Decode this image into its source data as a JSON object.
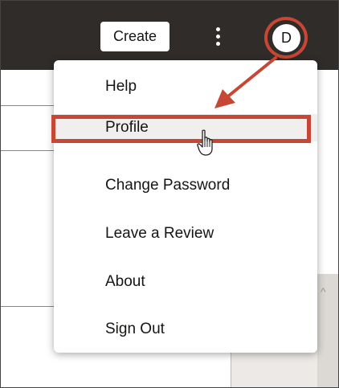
{
  "header": {
    "create_label": "Create",
    "avatar_initial": "D"
  },
  "menu": {
    "items": [
      {
        "label": "Help"
      },
      {
        "label": "Profile"
      },
      {
        "label": "Change Password"
      },
      {
        "label": "Leave a Review"
      },
      {
        "label": "About"
      },
      {
        "label": "Sign Out"
      }
    ],
    "active_item": "Profile"
  },
  "icons": {
    "more": "kebab-vertical-icon",
    "pointer": "hand-pointer-icon",
    "arrow": "callout-arrow",
    "scroll_up": "chevron-up-icon"
  },
  "colors": {
    "topbar": "#302c2a",
    "highlight": "#c74634",
    "menu_hover": "#f1efed"
  }
}
